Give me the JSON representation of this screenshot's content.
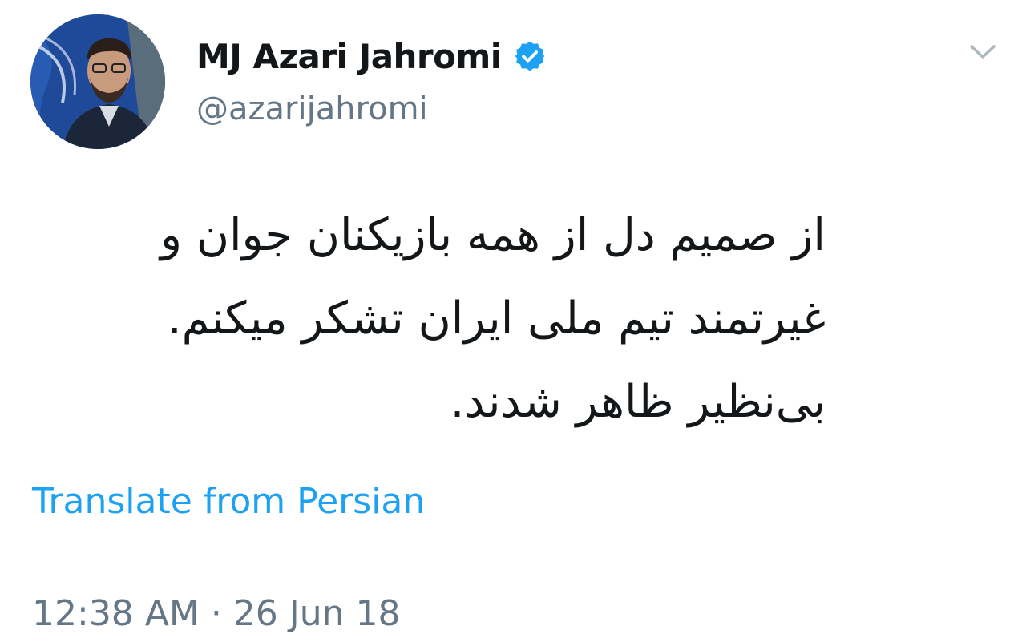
{
  "tweet": {
    "author": {
      "display_name": "MJ Azari Jahromi",
      "handle": "@azarijahromi",
      "verified": true,
      "avatar_icon": "profile-photo"
    },
    "menu_icon": "chevron-down-icon",
    "text_lines": [
      "از صمیم دل از همه بازیکنان جوان و",
      "غیرتمند تیم ملی ایران تشکر میکنم.",
      "بی‌نظیر ظاهر شدند."
    ],
    "translate_label": "Translate from Persian",
    "timestamp": "12:38 AM · 26 Jun 18"
  },
  "colors": {
    "text": "#14171a",
    "secondary": "#657786",
    "link": "#1da1f2",
    "verified_badge": "#1da1f2"
  }
}
